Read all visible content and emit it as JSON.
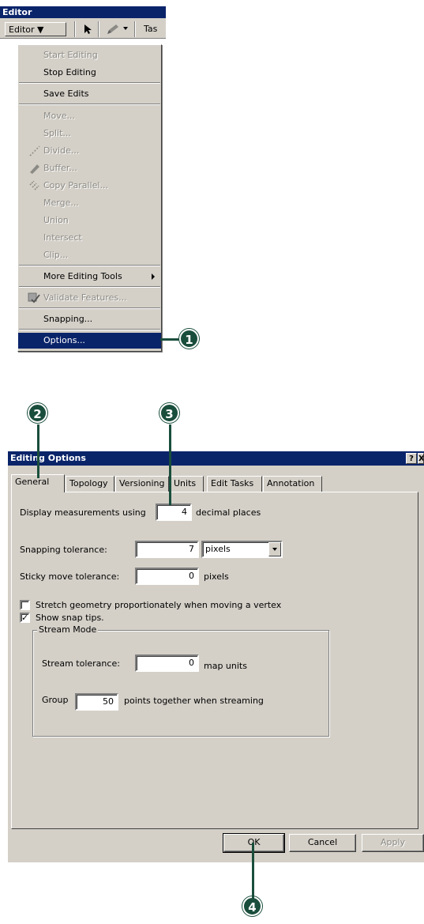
{
  "toolbar": {
    "title": "Editor",
    "editor_menu_label": "Editor ▼",
    "task_label": "Tas"
  },
  "menu": {
    "items": [
      {
        "label": "Start Editing",
        "enabled": false
      },
      {
        "label": "Stop Editing",
        "enabled": true
      },
      {
        "label": "Save Edits",
        "enabled": true
      },
      {
        "label": "Move...",
        "enabled": false
      },
      {
        "label": "Split...",
        "enabled": false
      },
      {
        "label": "Divide...",
        "enabled": false,
        "icon": "divide-icon"
      },
      {
        "label": "Buffer...",
        "enabled": false,
        "icon": "buffer-icon"
      },
      {
        "label": "Copy Parallel...",
        "enabled": false,
        "icon": "copy-parallel-icon"
      },
      {
        "label": "Merge...",
        "enabled": false
      },
      {
        "label": "Union",
        "enabled": false
      },
      {
        "label": "Intersect",
        "enabled": false
      },
      {
        "label": "Clip...",
        "enabled": false
      },
      {
        "label": "More Editing Tools",
        "enabled": true,
        "submenu": true
      },
      {
        "label": "Validate Features...",
        "enabled": false,
        "icon": "validate-icon"
      },
      {
        "label": "Snapping...",
        "enabled": true
      },
      {
        "label": "Options...",
        "enabled": true,
        "selected": true
      }
    ]
  },
  "callouts": [
    "1",
    "2",
    "3",
    "4"
  ],
  "dialog": {
    "title": "Editing Options",
    "help_glyph": "?",
    "close_glyph": "X",
    "tabs": [
      "General",
      "Topology",
      "Versioning",
      "Units",
      "Edit Tasks",
      "Annotation"
    ],
    "active_tab": "General",
    "display_measurements_label": "Display measurements using",
    "decimal_places_value": "4",
    "decimal_places_suffix": "decimal places",
    "snapping_tolerance_label": "Snapping tolerance:",
    "snapping_tolerance_value": "7",
    "snapping_units_value": "pixels",
    "sticky_move_label": "Sticky move tolerance:",
    "sticky_move_value": "0",
    "sticky_move_units": "pixels",
    "stretch_geometry_label": "Stretch geometry proportionately when moving a vertex",
    "stretch_geometry_checked": false,
    "show_snap_tips_label": "Show snap tips.",
    "show_snap_tips_checked": true,
    "check_glyph": "✓",
    "stream_mode_label": "Stream Mode",
    "stream_tolerance_label": "Stream tolerance:",
    "stream_tolerance_value": "0",
    "stream_tolerance_units": "map units",
    "group_label": "Group",
    "group_value": "50",
    "group_suffix": "points together when streaming",
    "ok_label": "OK",
    "cancel_label": "Cancel",
    "apply_label": "Apply"
  },
  "colors": {
    "title_bar": "#0a246a",
    "callout": "#1a4e3c",
    "face": "#d4d0c8"
  }
}
